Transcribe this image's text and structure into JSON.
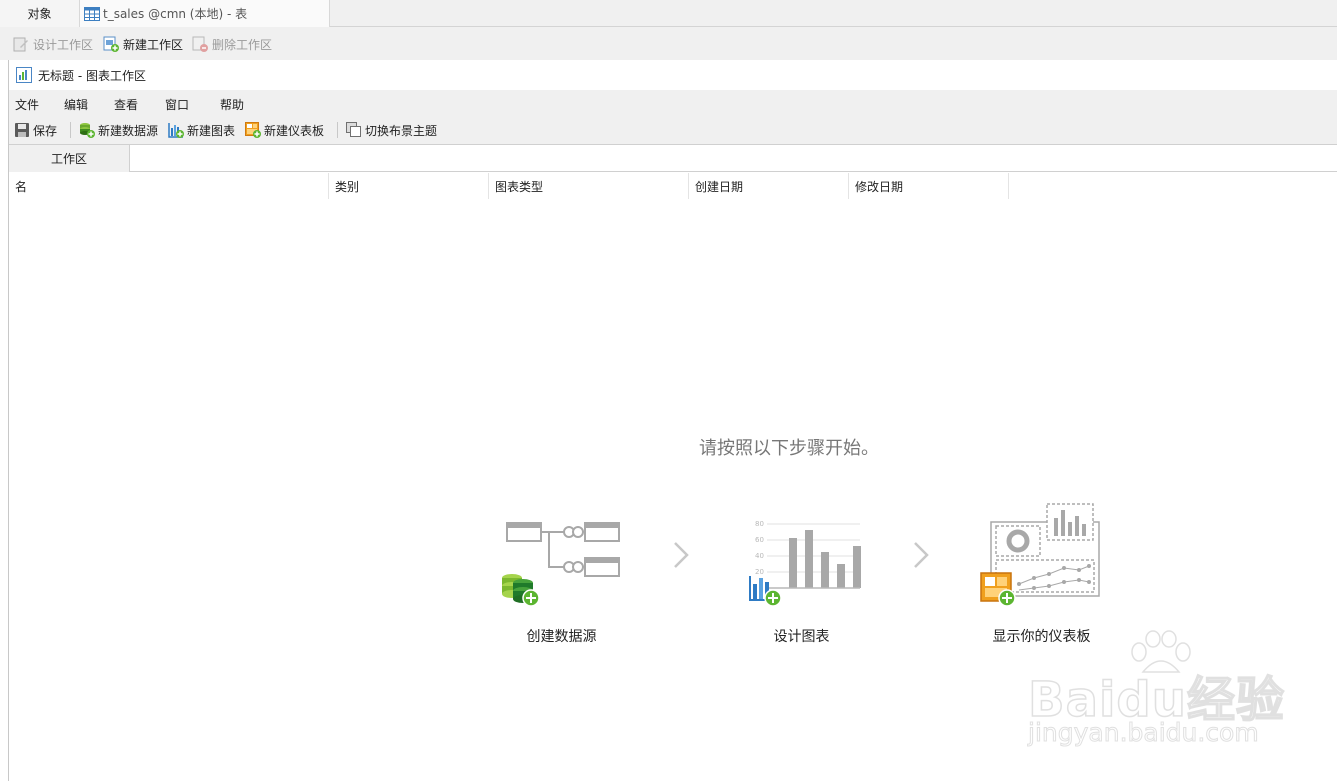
{
  "outer_tabs": [
    {
      "label": "对象"
    },
    {
      "label": "t_sales @cmn (本地) - 表",
      "icon": "table-icon"
    }
  ],
  "outer_toolbar": [
    {
      "label": "设计工作区",
      "icon": "design-workspace-icon",
      "enabled": false
    },
    {
      "label": "新建工作区",
      "icon": "new-workspace-icon",
      "enabled": true
    },
    {
      "label": "删除工作区",
      "icon": "delete-workspace-icon",
      "enabled": false
    }
  ],
  "window": {
    "title": "无标题 - 图表工作区",
    "icon": "chart-workspace-icon"
  },
  "menu": [
    "文件",
    "编辑",
    "查看",
    "窗口",
    "帮助"
  ],
  "toolbar": [
    {
      "label": "保存",
      "icon": "save-icon"
    },
    {
      "label": "新建数据源",
      "icon": "new-datasource-icon"
    },
    {
      "label": "新建图表",
      "icon": "new-chart-icon"
    },
    {
      "label": "新建仪表板",
      "icon": "new-dashboard-icon"
    },
    {
      "label": "切换布景主题",
      "icon": "switch-theme-icon"
    }
  ],
  "workspace_tab": "工作区",
  "columns": [
    "名",
    "类别",
    "图表类型",
    "创建日期",
    "修改日期"
  ],
  "empty_state": {
    "prompt": "请按照以下步骤开始。",
    "steps": [
      {
        "label": "创建数据源",
        "icon": "create-datasource-illustration"
      },
      {
        "label": "设计图表",
        "icon": "design-chart-illustration",
        "axis_ticks": [
          "80",
          "60",
          "40",
          "20"
        ]
      },
      {
        "label": "显示你的仪表板",
        "icon": "dashboard-illustration"
      }
    ]
  },
  "watermark": {
    "main": "Baidu经验",
    "sub": "jingyan.baidu.com"
  },
  "colors": {
    "chrome": "#f0f0f0",
    "accent_green": "#5cb531",
    "accent_orange": "#f0a01e",
    "chart_blue": "#2e7bc4",
    "illustration_gray": "#a8a8a8"
  }
}
